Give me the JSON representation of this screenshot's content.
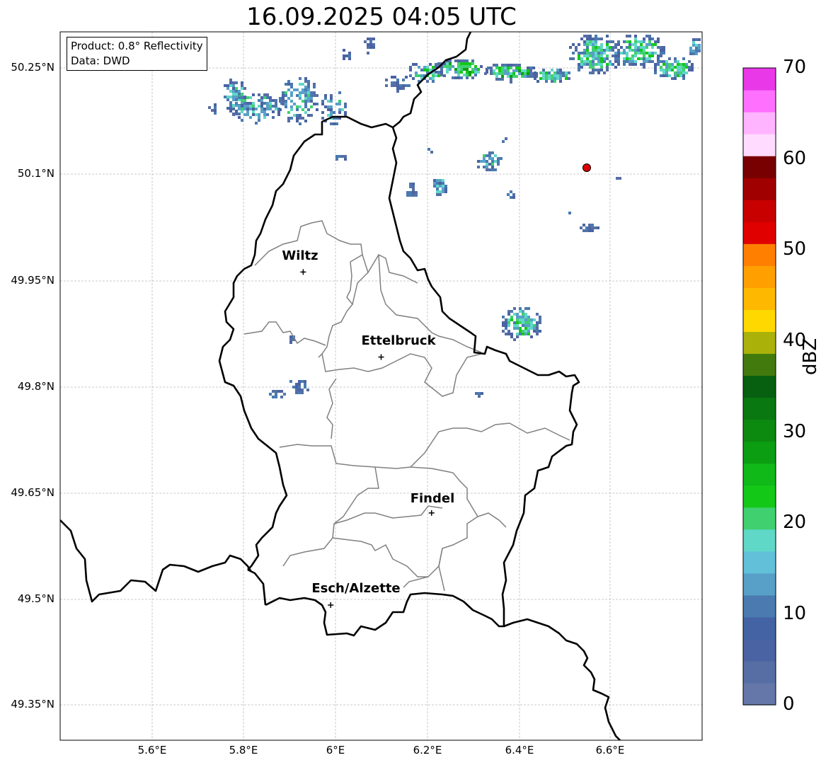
{
  "title": "16.09.2025 04:05 UTC",
  "info": {
    "product": "Product: 0.8° Reflectivity",
    "data": "Data: DWD"
  },
  "axes": {
    "x_ticks": [
      "5.6°E",
      "5.8°E",
      "6°E",
      "6.2°E",
      "6.4°E",
      "6.6°E"
    ],
    "y_ticks": [
      "50.25°N",
      "50.1°N",
      "49.95°N",
      "49.8°N",
      "49.65°N",
      "49.5°N",
      "49.35°N"
    ]
  },
  "cities": [
    {
      "name": "Wiltz"
    },
    {
      "name": "Ettelbruck"
    },
    {
      "name": "Findel"
    },
    {
      "name": "Esch/Alzette"
    }
  ],
  "colorbar": {
    "label": "dBZ",
    "ticks": [
      "0",
      "10",
      "20",
      "30",
      "40",
      "50",
      "60",
      "70"
    ],
    "colors": [
      "#6477a8",
      "#566ea4",
      "#4a63a2",
      "#4463a4",
      "#4a7ab0",
      "#58a0c8",
      "#62c0d8",
      "#60d8c8",
      "#40d070",
      "#14c818",
      "#10b818",
      "#0c9e12",
      "#0c8a10",
      "#0a7810",
      "#066010",
      "#427a0e",
      "#aab20a",
      "#ffd800",
      "#ffb800",
      "#ffa000",
      "#ff8000",
      "#e00000",
      "#c80000",
      "#a00000",
      "#780000",
      "#ffdcff",
      "#ffb4ff",
      "#ff70ff",
      "#e838e8"
    ]
  },
  "marker": {
    "color": "#dd0000"
  },
  "chart_data": {
    "type": "map",
    "title": "16.09.2025 04:05 UTC",
    "lon_range": [
      5.4,
      6.8
    ],
    "lat_range": [
      49.3,
      50.3
    ],
    "grid": true,
    "colorbar_range": [
      0,
      70
    ],
    "colorbar_label": "dBZ",
    "cities": [
      {
        "name": "Wiltz",
        "lon": 5.93,
        "lat": 49.97
      },
      {
        "name": "Ettelbruck",
        "lon": 6.1,
        "lat": 49.85
      },
      {
        "name": "Findel",
        "lon": 6.21,
        "lat": 49.63
      },
      {
        "name": "Esch/Alzette",
        "lon": 5.99,
        "lat": 49.5
      }
    ],
    "marker": {
      "lon": 6.55,
      "lat": 50.11
    }
  }
}
